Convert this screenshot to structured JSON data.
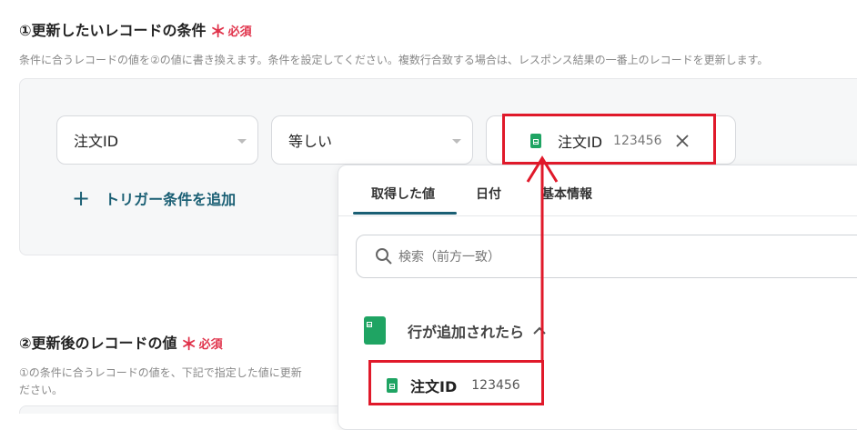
{
  "section1": {
    "title": "①更新したいレコードの条件",
    "required_mark": "＊",
    "required_label": "必須",
    "description": "条件に合うレコードの値を②の値に書き換えます。条件を設定してください。複数行合致する場合は、レスポンス結果の一番上のレコードを更新します。"
  },
  "condition": {
    "field_select": "注文ID",
    "operator_select": "等しい",
    "value_chip": {
      "label": "注文ID",
      "value": "123456"
    },
    "add_trigger_label": "トリガー条件を追加"
  },
  "section2": {
    "title": "②更新後のレコードの値",
    "required_mark": "＊",
    "required_label": "必須",
    "description_line1": "①の条件に合うレコードの値を、下記で指定した値に更新",
    "description_line2": "ださい。"
  },
  "dropdown": {
    "tabs": [
      "取得した値",
      "日付",
      "基本情報"
    ],
    "active_tab": 0,
    "search_placeholder": "検索（前方一致）",
    "group_label": "行が追加されたら",
    "item": {
      "label": "注文ID",
      "value": "123456"
    }
  },
  "colors": {
    "accent": "#1a5f74",
    "required": "#e0334b",
    "annotation_red": "#e0192a",
    "sheets_green": "#1fa463"
  }
}
